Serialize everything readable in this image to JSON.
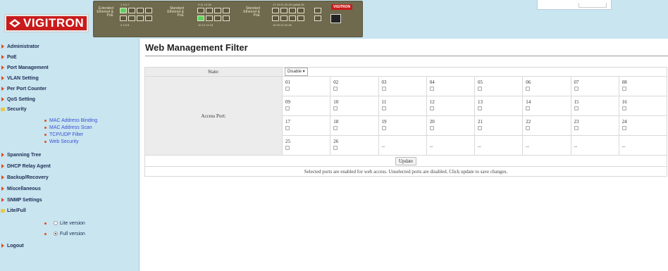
{
  "logo": {
    "text": "VIGITRON"
  },
  "switch": {
    "group1_label": "Extended Ethernet & PoE",
    "group1_top_nums": "1  3  5  7",
    "group1_bottom_nums": "2  4  6  8",
    "group2_label": "Standard Ethernet & PoE",
    "group2_top_nums": "9  11  13  15",
    "group2_bottom_nums": "10  12  14  16",
    "group3_label": "Standard Ethernet & PoE",
    "group3_top_nums": "17  19  21  23  25 Uplink 26",
    "group3_bottom_nums": "18  20  22  24  26",
    "badge": "VIGITRON"
  },
  "sidebar": {
    "items": [
      {
        "label": "Administrator"
      },
      {
        "label": "PoE"
      },
      {
        "label": "Port Management"
      },
      {
        "label": "VLAN Setting"
      },
      {
        "label": "Per Port Counter"
      },
      {
        "label": "QoS Setting"
      },
      {
        "label": "Security"
      },
      {
        "label": "Spanning Tree"
      },
      {
        "label": "DHCP Relay Agent"
      },
      {
        "label": "Backup/Recovery"
      },
      {
        "label": "Miscellaneous"
      },
      {
        "label": "SNMP Settings"
      },
      {
        "label": "Lite/Full"
      },
      {
        "label": "Logout"
      }
    ],
    "security_sub": [
      {
        "label": "MAC Address Binding"
      },
      {
        "label": "MAC Address Scan"
      },
      {
        "label": "TCP/UDP Filter"
      },
      {
        "label": "Web Security"
      }
    ],
    "version_options": [
      {
        "label": "Lite version",
        "checked": false
      },
      {
        "label": "Full version",
        "checked": true
      }
    ]
  },
  "main": {
    "title": "Web Management Filter",
    "state_label": "State:",
    "state_value": "Disable",
    "access_port_label": "Access Port:",
    "ports": [
      "01",
      "02",
      "03",
      "04",
      "05",
      "06",
      "07",
      "08",
      "09",
      "10",
      "11",
      "12",
      "13",
      "14",
      "15",
      "16",
      "17",
      "18",
      "19",
      "20",
      "21",
      "22",
      "23",
      "24",
      "25",
      "26"
    ],
    "empty_cell": "--",
    "update_label": "Update",
    "note": "Selected ports are enabled for web access. Unselected ports are disabled. Click update to save changes."
  }
}
